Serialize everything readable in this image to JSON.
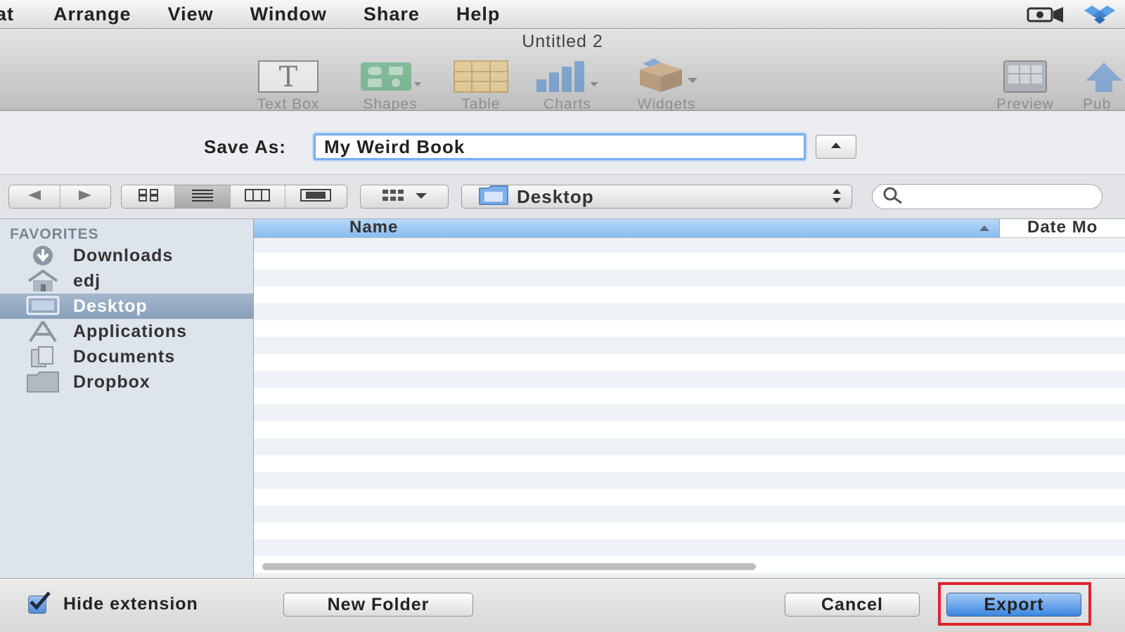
{
  "menubar": {
    "items": [
      "at",
      "Arrange",
      "View",
      "Window",
      "Share",
      "Help"
    ],
    "right_icons": [
      "screen-recording-icon",
      "dropbox-icon"
    ]
  },
  "window": {
    "title": "Untitled 2"
  },
  "toolbar": {
    "items": [
      {
        "label": "Text Box",
        "icon": "text-box-icon"
      },
      {
        "label": "Shapes",
        "icon": "shapes-icon"
      },
      {
        "label": "Table",
        "icon": "table-icon"
      },
      {
        "label": "Charts",
        "icon": "charts-icon"
      },
      {
        "label": "Widgets",
        "icon": "widgets-icon"
      },
      {
        "label": "Preview",
        "icon": "preview-icon"
      },
      {
        "label": "Pub",
        "icon": "publish-icon"
      }
    ]
  },
  "save_as": {
    "label": "Save As:",
    "value": "My Weird Book"
  },
  "navigation": {
    "location": "Desktop",
    "search_placeholder": ""
  },
  "sidebar": {
    "header": "FAVORITES",
    "items": [
      {
        "label": "Downloads",
        "icon": "downloads-icon"
      },
      {
        "label": "edj",
        "icon": "home-icon"
      },
      {
        "label": "Desktop",
        "icon": "desktop-icon",
        "selected": true
      },
      {
        "label": "Applications",
        "icon": "applications-icon"
      },
      {
        "label": "Documents",
        "icon": "documents-icon"
      },
      {
        "label": "Dropbox",
        "icon": "folder-icon"
      }
    ]
  },
  "file_list": {
    "columns": [
      "Name",
      "Date Mo"
    ],
    "sort_column": "Name",
    "rows": []
  },
  "footer": {
    "hide_extension_label": "Hide extension",
    "hide_extension_checked": true,
    "new_folder_label": "New Folder",
    "cancel_label": "Cancel",
    "export_label": "Export"
  },
  "colors": {
    "accent": "#4f8ad6",
    "selection": "#8aa0ba",
    "highlight": "#e0232a"
  }
}
